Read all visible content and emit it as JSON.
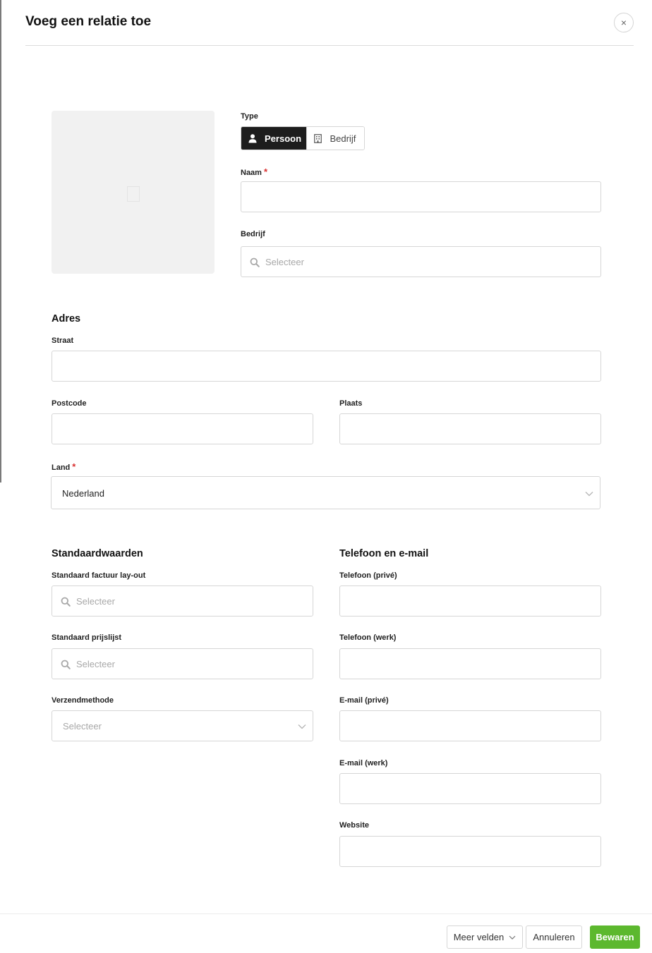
{
  "header": {
    "title": "Voeg een relatie toe",
    "close_icon": "close-icon",
    "close_glyph": "×"
  },
  "type": {
    "label": "Type",
    "options": [
      {
        "label": "Persoon",
        "icon": "user-icon"
      },
      {
        "label": "Bedrijf",
        "icon": "building-icon"
      }
    ],
    "selected": "Persoon"
  },
  "naam": {
    "label": "Naam",
    "required_mark": "*",
    "value": ""
  },
  "bedrijf": {
    "label": "Bedrijf",
    "placeholder": "Selecteer"
  },
  "adres": {
    "title": "Adres",
    "straat": {
      "label": "Straat",
      "value": ""
    },
    "postcode": {
      "label": "Postcode",
      "value": ""
    },
    "plaats": {
      "label": "Plaats",
      "value": ""
    },
    "land": {
      "label": "Land",
      "required_mark": "*",
      "value": "Nederland"
    }
  },
  "standaardwaarden": {
    "title": "Standaardwaarden",
    "factuur_layout": {
      "label": "Standaard factuur lay-out",
      "placeholder": "Selecteer"
    },
    "prijslijst": {
      "label": "Standaard prijslijst",
      "placeholder": "Selecteer"
    },
    "verzendmethode": {
      "label": "Verzendmethode",
      "placeholder": "Selecteer"
    }
  },
  "contact": {
    "title": "Telefoon en e-mail",
    "telefoon_prive": {
      "label": "Telefoon (privé)",
      "value": ""
    },
    "telefoon_werk": {
      "label": "Telefoon (werk)",
      "value": ""
    },
    "email_prive": {
      "label": "E-mail (privé)",
      "value": ""
    },
    "email_werk": {
      "label": "E-mail (werk)",
      "value": ""
    },
    "website": {
      "label": "Website",
      "value": ""
    }
  },
  "footer": {
    "more_fields": "Meer velden",
    "cancel": "Annuleren",
    "save": "Bewaren"
  },
  "colors": {
    "primary": "#5cb82e",
    "active_segment": "#1d1d1d",
    "required": "#d93232"
  }
}
